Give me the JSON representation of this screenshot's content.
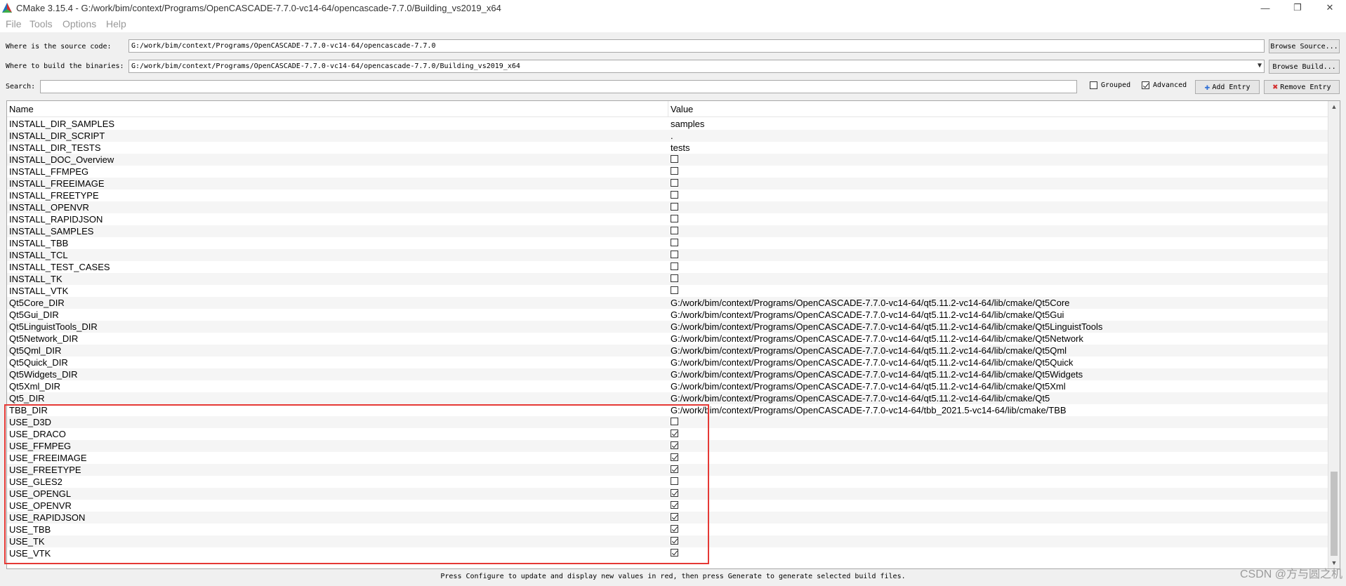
{
  "window": {
    "title": "CMake 3.15.4 - G:/work/bim/context/Programs/OpenCASCADE-7.7.0-vc14-64/opencascade-7.7.0/Building_vs2019_x64",
    "minimize": "—",
    "maximize": "❐",
    "close": "✕"
  },
  "menu": [
    "File",
    "Tools",
    "Options",
    "Help"
  ],
  "source": {
    "label": "Where is the source code:",
    "value": "G:/work/bim/context/Programs/OpenCASCADE-7.7.0-vc14-64/opencascade-7.7.0",
    "browse": "Browse Source..."
  },
  "build": {
    "label": "Where to build the binaries:",
    "value": "G:/work/bim/context/Programs/OpenCASCADE-7.7.0-vc14-64/opencascade-7.7.0/Building_vs2019_x64",
    "browse": "Browse Build..."
  },
  "search": {
    "label": "Search:",
    "value": ""
  },
  "options": {
    "grouped": "Grouped",
    "advanced": "Advanced"
  },
  "actions": {
    "add": "Add Entry",
    "remove": "Remove Entry"
  },
  "table": {
    "headers": {
      "name": "Name",
      "value": "Value"
    },
    "rows": [
      {
        "name": "INSTALL_DIR_SAMPLES",
        "value": "samples"
      },
      {
        "name": "INSTALL_DIR_SCRIPT",
        "value": "."
      },
      {
        "name": "INSTALL_DIR_TESTS",
        "value": "tests"
      },
      {
        "name": "INSTALL_DOC_Overview",
        "checked": false
      },
      {
        "name": "INSTALL_FFMPEG",
        "checked": false
      },
      {
        "name": "INSTALL_FREEIMAGE",
        "checked": false
      },
      {
        "name": "INSTALL_FREETYPE",
        "checked": false
      },
      {
        "name": "INSTALL_OPENVR",
        "checked": false
      },
      {
        "name": "INSTALL_RAPIDJSON",
        "checked": false
      },
      {
        "name": "INSTALL_SAMPLES",
        "checked": false
      },
      {
        "name": "INSTALL_TBB",
        "checked": false
      },
      {
        "name": "INSTALL_TCL",
        "checked": false
      },
      {
        "name": "INSTALL_TEST_CASES",
        "checked": false
      },
      {
        "name": "INSTALL_TK",
        "checked": false
      },
      {
        "name": "INSTALL_VTK",
        "checked": false
      },
      {
        "name": "Qt5Core_DIR",
        "value": "G:/work/bim/context/Programs/OpenCASCADE-7.7.0-vc14-64/qt5.11.2-vc14-64/lib/cmake/Qt5Core"
      },
      {
        "name": "Qt5Gui_DIR",
        "value": "G:/work/bim/context/Programs/OpenCASCADE-7.7.0-vc14-64/qt5.11.2-vc14-64/lib/cmake/Qt5Gui"
      },
      {
        "name": "Qt5LinguistTools_DIR",
        "value": "G:/work/bim/context/Programs/OpenCASCADE-7.7.0-vc14-64/qt5.11.2-vc14-64/lib/cmake/Qt5LinguistTools"
      },
      {
        "name": "Qt5Network_DIR",
        "value": "G:/work/bim/context/Programs/OpenCASCADE-7.7.0-vc14-64/qt5.11.2-vc14-64/lib/cmake/Qt5Network"
      },
      {
        "name": "Qt5Qml_DIR",
        "value": "G:/work/bim/context/Programs/OpenCASCADE-7.7.0-vc14-64/qt5.11.2-vc14-64/lib/cmake/Qt5Qml"
      },
      {
        "name": "Qt5Quick_DIR",
        "value": "G:/work/bim/context/Programs/OpenCASCADE-7.7.0-vc14-64/qt5.11.2-vc14-64/lib/cmake/Qt5Quick"
      },
      {
        "name": "Qt5Widgets_DIR",
        "value": "G:/work/bim/context/Programs/OpenCASCADE-7.7.0-vc14-64/qt5.11.2-vc14-64/lib/cmake/Qt5Widgets"
      },
      {
        "name": "Qt5Xml_DIR",
        "value": "G:/work/bim/context/Programs/OpenCASCADE-7.7.0-vc14-64/qt5.11.2-vc14-64/lib/cmake/Qt5Xml"
      },
      {
        "name": "Qt5_DIR",
        "value": "G:/work/bim/context/Programs/OpenCASCADE-7.7.0-vc14-64/qt5.11.2-vc14-64/lib/cmake/Qt5"
      },
      {
        "name": "TBB_DIR",
        "value": "G:/work/bim/context/Programs/OpenCASCADE-7.7.0-vc14-64/tbb_2021.5-vc14-64/lib/cmake/TBB"
      },
      {
        "name": "USE_D3D",
        "checked": false
      },
      {
        "name": "USE_DRACO",
        "checked": true
      },
      {
        "name": "USE_FFMPEG",
        "checked": true
      },
      {
        "name": "USE_FREEIMAGE",
        "checked": true
      },
      {
        "name": "USE_FREETYPE",
        "checked": true
      },
      {
        "name": "USE_GLES2",
        "checked": false
      },
      {
        "name": "USE_OPENGL",
        "checked": true
      },
      {
        "name": "USE_OPENVR",
        "checked": true
      },
      {
        "name": "USE_RAPIDJSON",
        "checked": true
      },
      {
        "name": "USE_TBB",
        "checked": true
      },
      {
        "name": "USE_TK",
        "checked": true
      },
      {
        "name": "USE_VTK",
        "checked": true
      }
    ]
  },
  "status": "Press Configure to update and display new values in red, then press Generate to generate selected build files.",
  "watermark": "CSDN @方与圆之机",
  "colors": {
    "highlight": "#e53935",
    "addIcon": "#2f6fd6",
    "removeIcon": "#d32f2f"
  }
}
